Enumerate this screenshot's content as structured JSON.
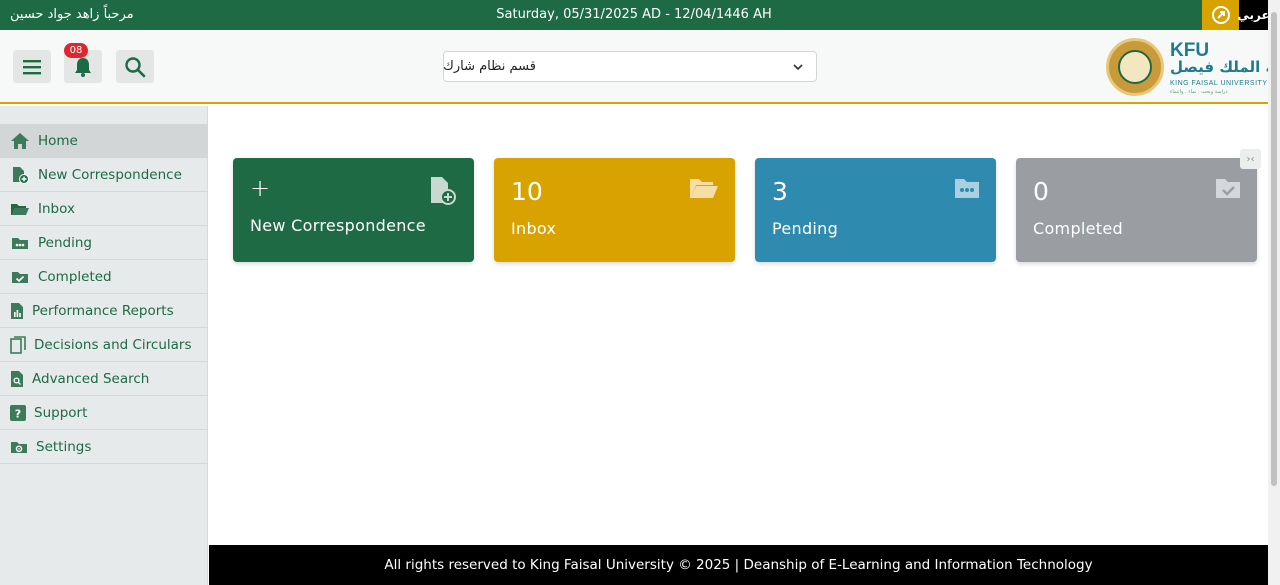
{
  "topbar": {
    "greeting": "مرحباً زاهد جواد حسين",
    "date": "Saturday, 05/31/2025 AD - 12/04/1446 AH",
    "language_label": "عربي"
  },
  "header": {
    "notification_count": "08",
    "department_select": {
      "selected": "قسم نظام شارك"
    },
    "logo": {
      "abbr": "KFU",
      "arabic_name": "جامعة الملك فيصل",
      "english_name": "KING FAISAL UNIVERSITY",
      "tagline": "دراسة وبحث . نماء . وانتماء"
    }
  },
  "sidebar": {
    "items": [
      {
        "label": "Home",
        "icon": "home-icon"
      },
      {
        "label": "New Correspondence",
        "icon": "file-add-icon"
      },
      {
        "label": "Inbox",
        "icon": "folder-open-icon"
      },
      {
        "label": "Pending",
        "icon": "folder-dots-icon"
      },
      {
        "label": "Completed",
        "icon": "folder-check-icon"
      },
      {
        "label": "Performance Reports",
        "icon": "report-icon"
      },
      {
        "label": "Decisions and Circulars",
        "icon": "documents-icon"
      },
      {
        "label": "Advanced Search",
        "icon": "search-doc-icon"
      },
      {
        "label": "Support",
        "icon": "question-icon"
      },
      {
        "label": "Settings",
        "icon": "settings-icon"
      }
    ]
  },
  "cards": [
    {
      "label": "New Correspondence",
      "value": "+",
      "color": "#1d6a45"
    },
    {
      "label": "Inbox",
      "value": "10",
      "color": "#d8a200"
    },
    {
      "label": "Pending",
      "value": "3",
      "color": "#2f8aaf"
    },
    {
      "label": "Completed",
      "value": "0",
      "color": "#9a9ea3"
    }
  ],
  "collapse_label": "›‹",
  "footer": {
    "text": "All rights reserved to King Faisal University © 2025 | Deanship of E-Learning and Information Technology"
  },
  "colors": {
    "brand_green": "#1d6a45",
    "accent_gold": "#d8a200",
    "pending_blue": "#2f8aaf",
    "completed_gray": "#9a9ea3"
  }
}
